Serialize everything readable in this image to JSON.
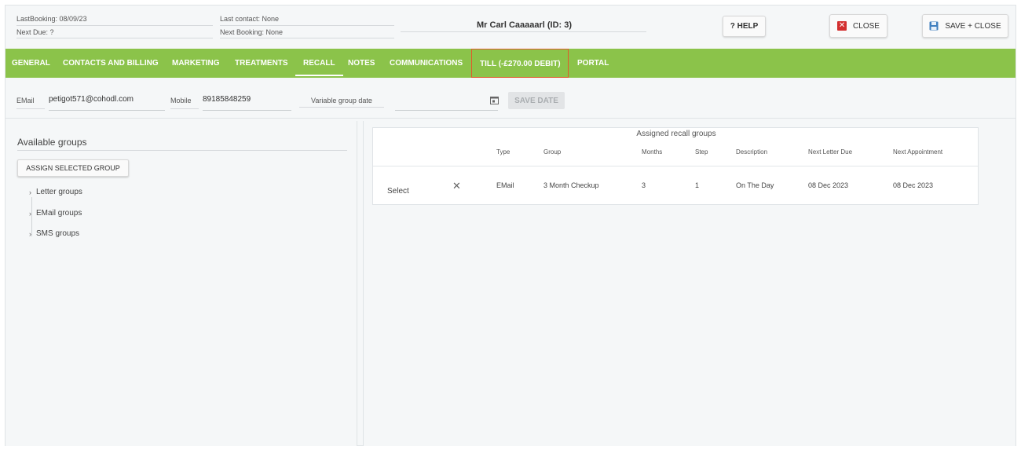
{
  "header": {
    "last_booking": "LastBooking: 08/09/23",
    "next_due": "Next Due: ?",
    "last_contact": "Last contact: None",
    "next_booking": "Next Booking: None",
    "patient_title": "Mr Carl Caaaaarl (ID: 3)",
    "help_label": "? HELP",
    "close_label": "CLOSE",
    "save_close_label": "SAVE + CLOSE"
  },
  "tabs": [
    "GENERAL",
    "CONTACTS AND BILLING",
    "MARKETING",
    "TREATMENTS",
    "RECALL",
    "NOTES",
    "COMMUNICATIONS",
    "TILL (-£270.00 DEBIT)",
    "PORTAL"
  ],
  "active_tab": "RECALL",
  "fields": {
    "email_label": "EMail",
    "email_value": "petigot571@cohodl.com",
    "mobile_label": "Mobile",
    "mobile_value": "89185848259",
    "vgdate_label": "Variable group date",
    "vgdate_value": "",
    "save_date_label": "SAVE DATE"
  },
  "available": {
    "title": "Available groups",
    "assign_label": "ASSIGN SELECTED GROUP",
    "groups": [
      "Letter groups",
      "EMail groups",
      "SMS groups"
    ]
  },
  "assigned": {
    "title": "Assigned recall groups",
    "columns": [
      "Type",
      "Group",
      "Months",
      "Step",
      "Description",
      "Next Letter Due",
      "Next Appointment"
    ],
    "rows": [
      {
        "select": "Select",
        "type": "EMail",
        "group": "3 Month Checkup",
        "months": "3",
        "step": "1",
        "description": "On The Day",
        "next_letter_due": "08 Dec 2023",
        "next_appointment": "08 Dec 2023"
      }
    ]
  },
  "colors": {
    "tab_bar": "#8bc34a",
    "till_border": "#e05a2a",
    "close_icon": "#d32f2f",
    "save_icon": "#3f7fbf"
  },
  "icons": [
    "close-icon",
    "save-icon",
    "calendar-icon",
    "remove-icon",
    "chevron-right-icon"
  ]
}
